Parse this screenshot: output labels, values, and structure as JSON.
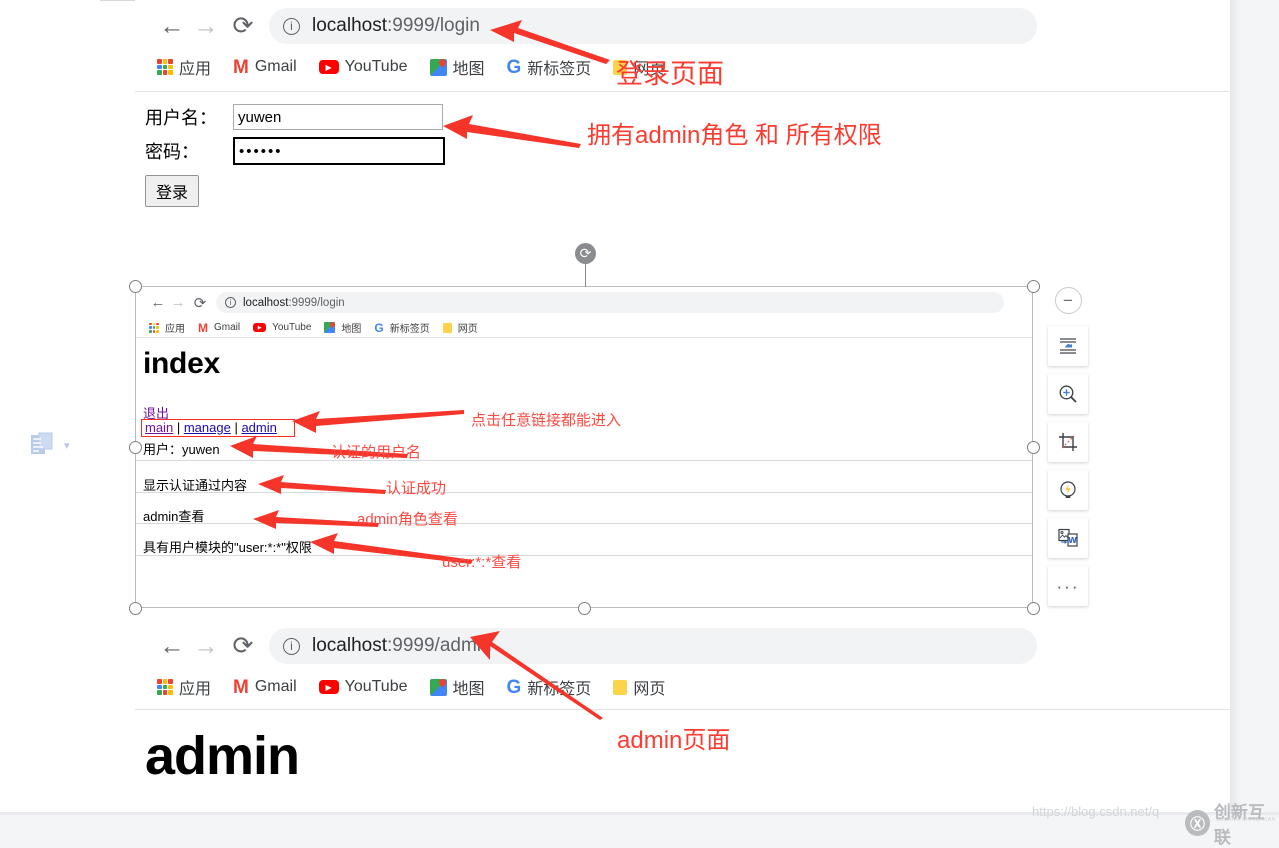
{
  "document": {
    "background_color": "#f4f5f7",
    "page_color": "#ffffff"
  },
  "top_browser": {
    "name": "login-page-screenshot",
    "nav": {
      "back": "←",
      "forward": "→",
      "reload": "⟳"
    },
    "address": {
      "info_icon": "ⓘ",
      "host": "localhost",
      "rest": ":9999/login",
      "full": "localhost:9999/login"
    },
    "bookmarks": [
      {
        "label": "应用",
        "icon": "apps-grid-icon"
      },
      {
        "label": "Gmail",
        "icon": "gmail-icon"
      },
      {
        "label": "YouTube",
        "icon": "youtube-icon"
      },
      {
        "label": "地图",
        "icon": "maps-icon"
      },
      {
        "label": "新标签页",
        "icon": "google-icon"
      },
      {
        "label": "网页",
        "icon": "folder-icon"
      }
    ]
  },
  "login_form": {
    "username_label": "用户名：",
    "username_value": "yuwen",
    "password_label": "密码：",
    "password_value": "••••••",
    "submit_label": "登录"
  },
  "annotations": {
    "login_page": "登录页面",
    "admin_role": "拥有admin角色 和 所有权限",
    "any_link": "点击任意链接都能进入",
    "auth_username": "认证的用户名",
    "auth_success": "认证成功",
    "admin_role_view": "admin角色查看",
    "user_perm_view": "user:*:*查看",
    "admin_page": "admin页面"
  },
  "embedded_screenshot": {
    "name": "index-page-screenshot",
    "nav": {
      "back": "←",
      "forward": "→",
      "reload": "⟳"
    },
    "address": {
      "info_icon": "ⓘ",
      "host": "localhost",
      "rest": ":9999/login",
      "full": "localhost:9999/login"
    },
    "bookmarks": [
      {
        "label": "应用",
        "icon": "apps-grid-icon"
      },
      {
        "label": "Gmail",
        "icon": "gmail-icon"
      },
      {
        "label": "YouTube",
        "icon": "youtube-icon"
      },
      {
        "label": "地图",
        "icon": "maps-icon"
      },
      {
        "label": "新标签页",
        "icon": "google-icon"
      },
      {
        "label": "网页",
        "icon": "folder-icon"
      }
    ],
    "page_title": "index",
    "logout_link": "退出",
    "links": [
      {
        "label": "main",
        "state": "visited"
      },
      {
        "label": "manage",
        "state": "link"
      },
      {
        "label": "admin",
        "state": "link"
      }
    ],
    "link_separator": "|",
    "user_line": "用户：yuwen",
    "rows": [
      "显示认证通过内容",
      "admin查看",
      "具有用户模块的\"user:*:*\"权限"
    ]
  },
  "bottom_browser": {
    "name": "admin-page-screenshot",
    "nav": {
      "back": "←",
      "forward": "→",
      "reload": "⟳"
    },
    "address": {
      "info_icon": "ⓘ",
      "host": "localhost",
      "rest": ":9999/admin",
      "full": "localhost:9999/admin"
    },
    "bookmarks": [
      {
        "label": "应用",
        "icon": "apps-grid-icon"
      },
      {
        "label": "Gmail",
        "icon": "gmail-icon"
      },
      {
        "label": "YouTube",
        "icon": "youtube-icon"
      },
      {
        "label": "地图",
        "icon": "maps-icon"
      },
      {
        "label": "新标签页",
        "icon": "google-icon"
      },
      {
        "label": "网页",
        "icon": "folder-icon"
      }
    ],
    "page_title": "admin"
  },
  "float_toolbar": {
    "close_label": "−",
    "buttons": [
      {
        "name": "text-wrap-icon",
        "title": "环绕文字"
      },
      {
        "name": "zoom-in-icon",
        "title": "放大"
      },
      {
        "name": "crop-icon",
        "title": "裁剪"
      },
      {
        "name": "smart-lightbulb-icon",
        "title": "智能"
      },
      {
        "name": "image-to-doc-icon",
        "title": "图片转文字"
      },
      {
        "name": "more-options-icon",
        "title": "更多",
        "label": "···"
      }
    ]
  },
  "paste_widget": {
    "name": "paste-options-icon",
    "caret": "▾"
  },
  "watermark": {
    "url": "https://blog.csdn.net/q",
    "logo_mark": "Ⓧ",
    "logo_text": "创新互联",
    "logo_sub": "CHUANG XIN HU LIAN"
  }
}
